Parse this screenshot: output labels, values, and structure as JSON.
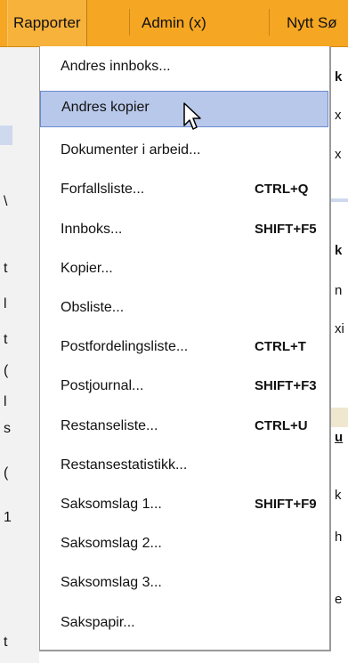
{
  "menubar": {
    "items": [
      {
        "label": "Rapporter"
      },
      {
        "label": "Admin (x)"
      },
      {
        "label": "Nytt Sø"
      }
    ]
  },
  "menu": {
    "items": [
      {
        "label": "Andres innboks...",
        "shortcut": ""
      },
      {
        "label": "Andres kopier",
        "shortcut": ""
      },
      {
        "label": "Dokumenter i arbeid...",
        "shortcut": ""
      },
      {
        "label": "Forfallsliste...",
        "shortcut": "CTRL+Q"
      },
      {
        "label": "Innboks...",
        "shortcut": "SHIFT+F5"
      },
      {
        "label": "Kopier...",
        "shortcut": ""
      },
      {
        "label": "Obsliste...",
        "shortcut": ""
      },
      {
        "label": "Postfordelingsliste...",
        "shortcut": "CTRL+T"
      },
      {
        "label": "Postjournal...",
        "shortcut": "SHIFT+F3"
      },
      {
        "label": "Restanseliste...",
        "shortcut": "CTRL+U"
      },
      {
        "label": "Restansestatistikk...",
        "shortcut": ""
      },
      {
        "label": "Saksomslag 1...",
        "shortcut": "SHIFT+F9"
      },
      {
        "label": "Saksomslag 2...",
        "shortcut": ""
      },
      {
        "label": "Saksomslag 3...",
        "shortcut": ""
      },
      {
        "label": "Sakspapir...",
        "shortcut": ""
      }
    ]
  },
  "background": {
    "left_glyphs": [
      "\\",
      "t",
      "l",
      "t",
      "(",
      "l",
      "s",
      "(",
      "1",
      "t"
    ],
    "right_glyphs": [
      "k",
      "x",
      "x",
      "k",
      "n",
      "xi",
      "u",
      "k",
      "h",
      "e"
    ]
  },
  "colors": {
    "menubar": "#f5a623",
    "highlight": "#b8c8ea",
    "highlight_border": "#6b8bd0"
  }
}
